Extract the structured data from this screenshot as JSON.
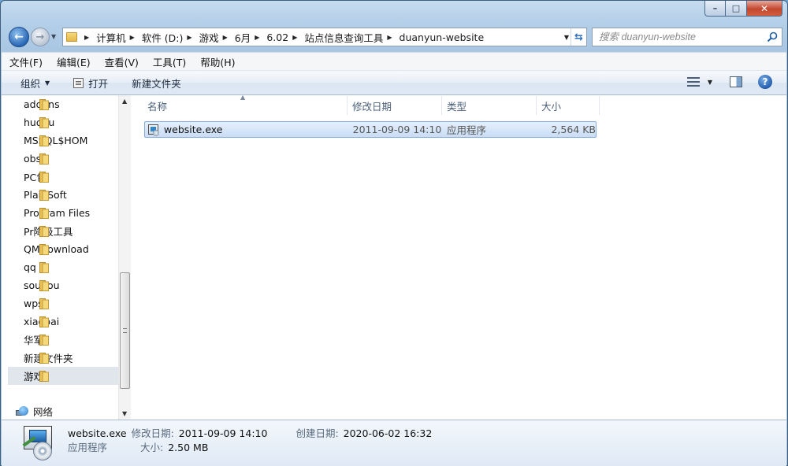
{
  "window": {
    "caption_buttons": {
      "minimize": "–",
      "maximize": "□",
      "close": "✕"
    }
  },
  "address_bar": {
    "breadcrumbs": [
      "计算机",
      "软件 (D:)",
      "游戏",
      "6月",
      "6.02",
      "站点信息查询工具",
      "duanyun-website"
    ]
  },
  "search": {
    "placeholder": "搜索 duanyun-website"
  },
  "menu": {
    "items": [
      "文件(F)",
      "编辑(E)",
      "查看(V)",
      "工具(T)",
      "帮助(H)"
    ]
  },
  "toolbar": {
    "organize_label": "组织",
    "open_label": "打开",
    "new_folder_label": "新建文件夹"
  },
  "nav": {
    "folders": [
      "addons",
      "huohu",
      "MSSQL$HOM",
      "obs",
      "PC包",
      "PlainSoft",
      "Program Files",
      "Pr降级工具",
      "QMDownload",
      "qq",
      "sougou",
      "wps",
      "xiaobai",
      "华军",
      "新建文件夹",
      "游戏"
    ],
    "selected": "游戏",
    "network_label": "网络"
  },
  "file_list": {
    "columns": {
      "name": "名称",
      "date": "修改日期",
      "type": "类型",
      "size": "大小"
    },
    "rows": [
      {
        "name": "website.exe",
        "date": "2011-09-09 14:10",
        "type": "应用程序",
        "size": "2,564 KB",
        "selected": true
      }
    ]
  },
  "details": {
    "name": "website.exe",
    "type": "应用程序",
    "modified_label": "修改日期:",
    "modified": "2011-09-09 14:10",
    "created_label": "创建日期:",
    "created": "2020-06-02 16:32",
    "size_label": "大小:",
    "size": "2.50 MB"
  },
  "colors": {
    "selection_border": "#84acdd",
    "selection_fill": "#c9ddf5",
    "frame": "#a9c6e3"
  }
}
